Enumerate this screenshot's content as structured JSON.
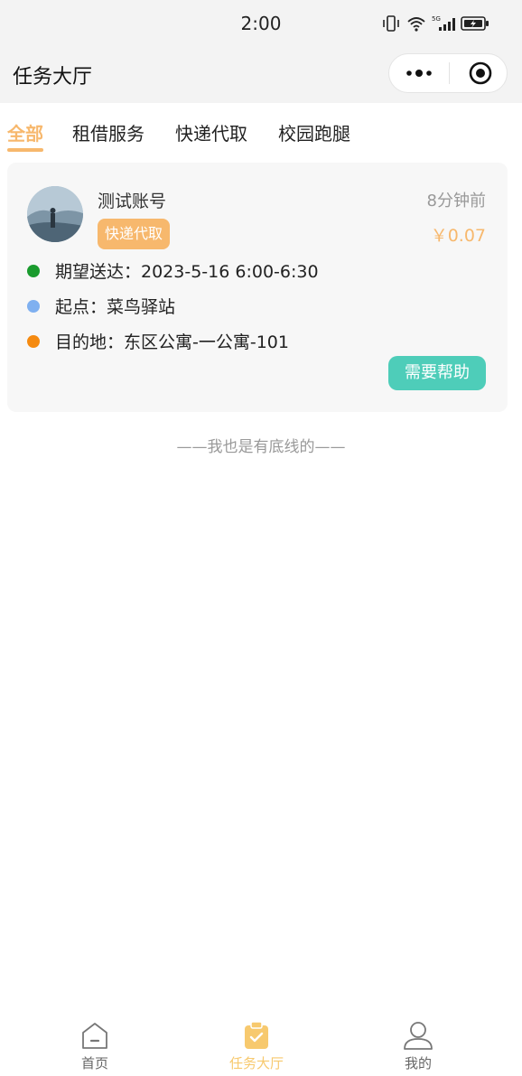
{
  "status_bar": {
    "time": "2:00"
  },
  "nav": {
    "title": "任务大厅"
  },
  "tabs": [
    {
      "label": "全部",
      "active": true
    },
    {
      "label": "租借服务",
      "active": false
    },
    {
      "label": "快递代取",
      "active": false
    },
    {
      "label": "校园跑腿",
      "active": false
    }
  ],
  "task": {
    "username": "测试账号",
    "time_ago": "8分钟前",
    "category": "快递代取",
    "price": "￥0.07",
    "rows": [
      {
        "text": "期望送达：2023-5-16 6:00-6:30",
        "color": "#1a9b2e"
      },
      {
        "text": "起点：菜鸟驿站",
        "color": "#7fb0f0"
      },
      {
        "text": "目的地：东区公寓-一公寓-101",
        "color": "#f58a10"
      }
    ],
    "action_label": "需要帮助"
  },
  "list_end_text": "——我也是有底线的——",
  "tab_bar": {
    "items": [
      {
        "label": "首页",
        "icon": "home-icon",
        "active": false
      },
      {
        "label": "任务大厅",
        "icon": "task-hall-icon",
        "active": true
      },
      {
        "label": "我的",
        "icon": "user-icon",
        "active": false
      }
    ]
  },
  "colors": {
    "accent": "#f7b86d",
    "action": "#4ecdb9",
    "tabbar_active": "#f7c96e"
  }
}
